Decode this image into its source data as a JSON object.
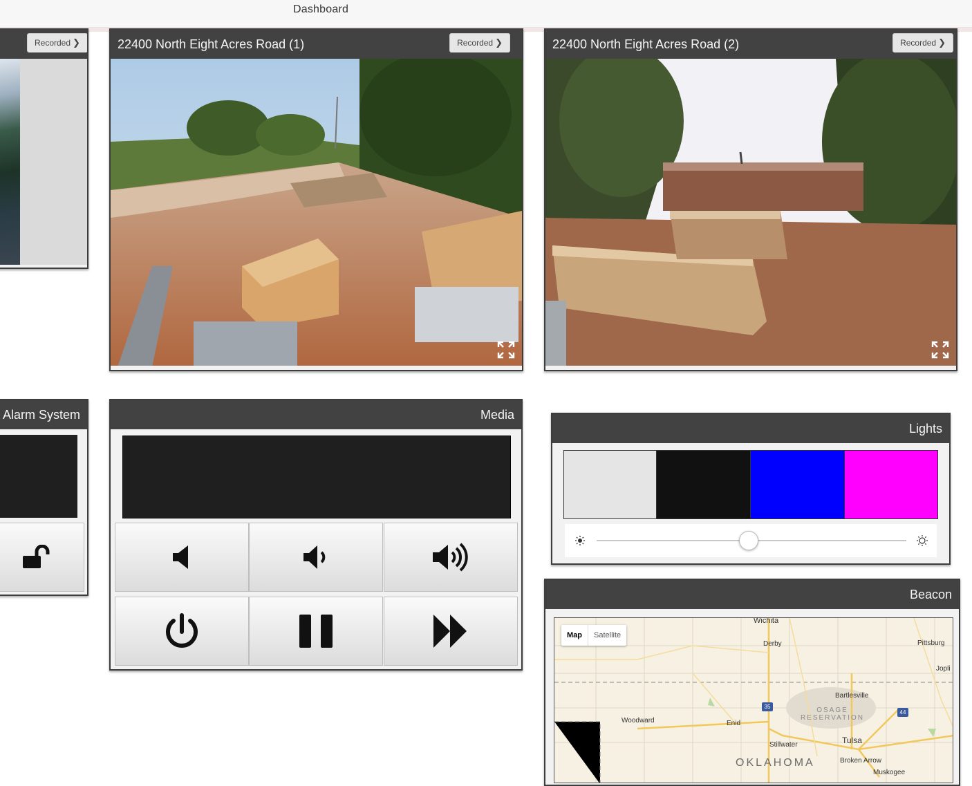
{
  "header": {
    "title": "Dashboard"
  },
  "cameras": [
    {
      "title": "",
      "recorded_label": "Recorded"
    },
    {
      "title": "22400 North Eight Acres Road (1)",
      "recorded_label": "Recorded"
    },
    {
      "title": "22400 North Eight Acres Road (2)",
      "recorded_label": "Recorded"
    }
  ],
  "alarm": {
    "title": "Alarm System",
    "lock_icon": "unlock-icon"
  },
  "media": {
    "title": "Media",
    "buttons": [
      "volume-mute-icon",
      "volume-down-icon",
      "volume-up-icon",
      "power-icon",
      "pause-icon",
      "fast-forward-icon"
    ]
  },
  "lights": {
    "title": "Lights",
    "colors": [
      "#e5e5e5",
      "#111111",
      "#0000ff",
      "#ff00ff"
    ],
    "brightness_fraction": 0.5
  },
  "beacon": {
    "title": "Beacon",
    "map_tabs": [
      "Map",
      "Satellite"
    ],
    "map_labels": {
      "wichita": "Wichita",
      "derby": "Derby",
      "pittsburg": "Pittsburg",
      "joplin": "Jopli",
      "bartlesville": "Bartlesville",
      "osage": "OSAGE RESERVATION",
      "woodward": "Woodward",
      "enid": "Enid",
      "stillwater": "Stillwater",
      "tulsa": "Tulsa",
      "oklahoma": "OKLAHOMA",
      "broken_arrow": "Broken Arrow",
      "muskogee": "Muskogee",
      "shield_35": "35",
      "shield_44": "44"
    }
  }
}
